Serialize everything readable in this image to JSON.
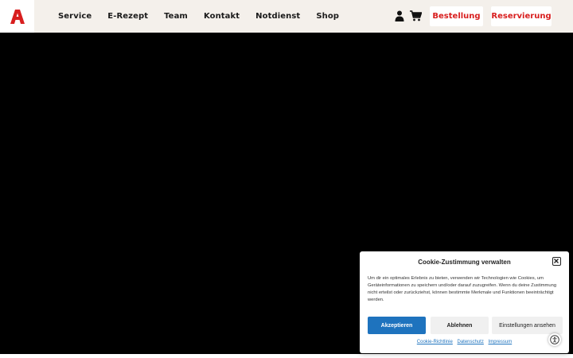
{
  "header": {
    "logo_icon": "apotheke-a-logo",
    "brand_color": "#d81e1e",
    "nav": [
      "Service",
      "E-Rezept",
      "Team",
      "Kontakt",
      "Notdienst",
      "Shop"
    ],
    "icons": [
      "user-icon",
      "cart-icon"
    ],
    "buttons": {
      "order": "Bestellung",
      "reservation": "Reservierung"
    }
  },
  "hero": {
    "background": "#000000"
  },
  "cookie_banner": {
    "title": "Cookie-Zustimmung verwalten",
    "text": "Um dir ein optimales Erlebnis zu bieten, verwenden wir Technologien wie Cookies, um Geräteinformationen zu speichern und/oder darauf zuzugreifen. Wenn du deine Zustimmung nicht erteilst oder zurückziehst, können bestimmte Merkmale und Funktionen beeinträchtigt werden.",
    "accept": "Akzeptieren",
    "deny": "Ablehnen",
    "settings": "Einstellungen ansehen",
    "links": [
      "Cookie-Richtlinie",
      "Datenschutz",
      "Impressum"
    ],
    "accent_color": "#1e73be"
  }
}
